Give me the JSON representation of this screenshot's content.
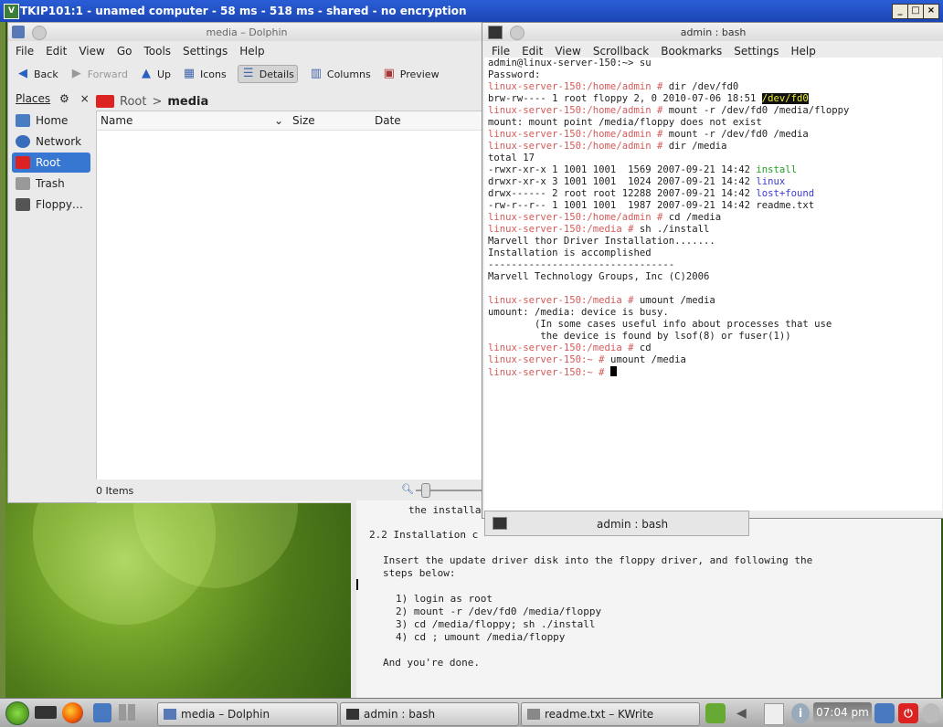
{
  "vnc": {
    "title": "TKIP101:1 - unamed computer - 58 ms - 518 ms - shared - no encryption",
    "icon": "vnc-icon"
  },
  "dolphin": {
    "title": "media – Dolphin",
    "menu": [
      "File",
      "Edit",
      "View",
      "Go",
      "Tools",
      "Settings",
      "Help"
    ],
    "toolbar": {
      "back": "Back",
      "forward": "Forward",
      "up": "Up",
      "icons": "Icons",
      "details": "Details",
      "columns": "Columns",
      "preview": "Preview"
    },
    "places_title": "Places",
    "places": [
      "Home",
      "Network",
      "Root",
      "Trash",
      "Floppy…"
    ],
    "breadcrumb_root": "Root",
    "breadcrumb_sep": ">",
    "breadcrumb_current": "media",
    "columns": {
      "name": "Name",
      "size": "Size",
      "date": "Date"
    },
    "status": "0 Items"
  },
  "terminal": {
    "title": "admin : bash",
    "menu": [
      "File",
      "Edit",
      "View",
      "Scrollback",
      "Bookmarks",
      "Settings",
      "Help"
    ],
    "tab_label": "admin : bash",
    "lines": [
      {
        "p": "",
        "t": "admin@linux-server-150:~> su"
      },
      {
        "p": "",
        "t": "Password:"
      },
      {
        "p": "linux-server-150:/home/admin # ",
        "t": "dir /dev/fd0"
      },
      {
        "p": "",
        "t": "brw-rw---- 1 root floppy 2, 0 2010-07-06 18:51 ",
        "hl": "/dev/fd0"
      },
      {
        "p": "linux-server-150:/home/admin # ",
        "t": "mount -r /dev/fd0 /media/floppy"
      },
      {
        "p": "",
        "t": "mount: mount point /media/floppy does not exist"
      },
      {
        "p": "linux-server-150:/home/admin # ",
        "t": "mount -r /dev/fd0 /media"
      },
      {
        "p": "linux-server-150:/home/admin # ",
        "t": "dir /media"
      },
      {
        "p": "",
        "t": "total 17"
      },
      {
        "p": "",
        "t": "-rwxr-xr-x 1 1001 1001  1569 2007-09-21 14:42 ",
        "g": "install"
      },
      {
        "p": "",
        "t": "drwxr-xr-x 3 1001 1001  1024 2007-09-21 14:42 ",
        "b": "linux"
      },
      {
        "p": "",
        "t": "drwx------ 2 root root 12288 2007-09-21 14:42 ",
        "b": "lost+found"
      },
      {
        "p": "",
        "t": "-rw-r--r-- 1 1001 1001  1987 2007-09-21 14:42 readme.txt"
      },
      {
        "p": "linux-server-150:/home/admin # ",
        "t": "cd /media"
      },
      {
        "p": "linux-server-150:/media # ",
        "t": "sh ./install"
      },
      {
        "p": "",
        "t": "Marvell thor Driver Installation......."
      },
      {
        "p": "",
        "t": "Installation is accomplished"
      },
      {
        "p": "",
        "t": "--------------------------------"
      },
      {
        "p": "",
        "t": "Marvell Technology Groups, Inc (C)2006"
      },
      {
        "p": "",
        "t": ""
      },
      {
        "p": "linux-server-150:/media # ",
        "t": "umount /media"
      },
      {
        "p": "",
        "t": "umount: /media: device is busy."
      },
      {
        "p": "",
        "t": "        (In some cases useful info about processes that use"
      },
      {
        "p": "",
        "t": "         the device is found by lsof(8) or fuser(1))"
      },
      {
        "p": "linux-server-150:/media # ",
        "t": "cd"
      },
      {
        "p": "linux-server-150:~ # ",
        "t": "umount /media"
      },
      {
        "p": "linux-server-150:~ # ",
        "t": "",
        "cursor": true
      }
    ]
  },
  "kwrite": {
    "lines": [
      "the installa",
      "2.2 Installation c",
      "Insert the update driver disk into the floppy driver, and following the",
      "steps below:",
      "1) login as root",
      "2) mount -r /dev/fd0 /media/floppy",
      "3) cd /media/floppy; sh ./install",
      "4) cd ; umount /media/floppy",
      "And you're done."
    ]
  },
  "taskbar": {
    "tasks": [
      "media – Dolphin",
      "admin : bash",
      "readme.txt – KWrite"
    ],
    "clock": "07:04 pm"
  }
}
